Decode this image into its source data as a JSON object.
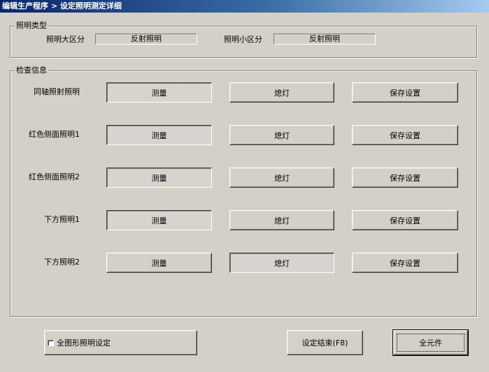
{
  "window": {
    "title": "编辑生产程序 > 设定照明测定详细"
  },
  "lighting_type": {
    "legend": "照明类型",
    "major_label": "照明大区分",
    "major_value": "反射照明",
    "minor_label": "照明小区分",
    "minor_value": "反射照明"
  },
  "inspection": {
    "legend": "检查信息",
    "rows": [
      {
        "label": "同轴照射照明",
        "measure": "测量",
        "light": "熄灯",
        "save": "保存设置",
        "measure_pressed": true,
        "light_pressed": false
      },
      {
        "label": "红色侧面照明1",
        "measure": "测量",
        "light": "熄灯",
        "save": "保存设置",
        "measure_pressed": true,
        "light_pressed": false
      },
      {
        "label": "红色侧面照明2",
        "measure": "测量",
        "light": "熄灯",
        "save": "保存设置",
        "measure_pressed": true,
        "light_pressed": false
      },
      {
        "label": "下方照明1",
        "measure": "测量",
        "light": "熄灯",
        "save": "保存设置",
        "measure_pressed": true,
        "light_pressed": false
      },
      {
        "label": "下方照明2",
        "measure": "测量",
        "light": "熄灯",
        "save": "保存设置",
        "measure_pressed": false,
        "light_pressed": true
      }
    ]
  },
  "footer": {
    "checkbox_label": "全图形照明设定",
    "checkbox_checked": false,
    "finish_label": "设定结束(F8)",
    "all_parts_label": "全元件"
  }
}
